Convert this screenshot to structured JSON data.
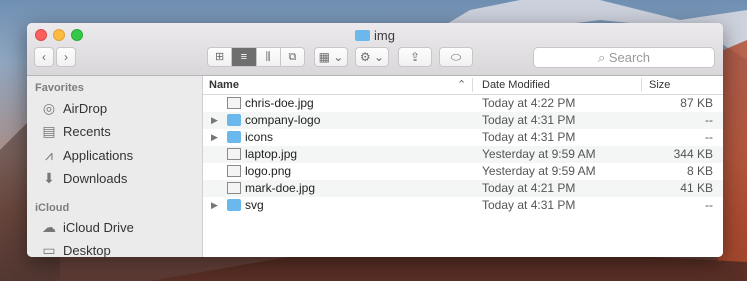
{
  "window": {
    "title": "img"
  },
  "toolbar": {
    "back": "‹",
    "forward": "›",
    "view_icon": "⊞",
    "view_list": "≡",
    "view_columns": "⫼",
    "view_cover": "⧉",
    "group": "▦ ⌄",
    "action": "⚙ ⌄",
    "share": "⇪",
    "tag": "⬭",
    "search_placeholder": "Search"
  },
  "sidebar": {
    "favorites_label": "Favorites",
    "favorites": [
      {
        "label": "AirDrop",
        "icon": "airdrop-icon",
        "glyph": "◎"
      },
      {
        "label": "Recents",
        "icon": "recents-icon",
        "glyph": "▤"
      },
      {
        "label": "Applications",
        "icon": "applications-icon",
        "glyph": "⩘"
      },
      {
        "label": "Downloads",
        "icon": "downloads-icon",
        "glyph": "⬇"
      }
    ],
    "icloud_label": "iCloud",
    "icloud": [
      {
        "label": "iCloud Drive",
        "icon": "cloud-icon",
        "glyph": "☁"
      },
      {
        "label": "Desktop",
        "icon": "desktop-icon",
        "glyph": "▭"
      }
    ]
  },
  "columns": {
    "name": "Name",
    "sort": "⌃",
    "date": "Date Modified",
    "size": "Size"
  },
  "files": [
    {
      "name": "chris-doe.jpg",
      "date": "Today at 4:22 PM",
      "size": "87 KB",
      "kind": "image",
      "expandable": false
    },
    {
      "name": "company-logo",
      "date": "Today at 4:31 PM",
      "size": "--",
      "kind": "folder",
      "expandable": true
    },
    {
      "name": "icons",
      "date": "Today at 4:31 PM",
      "size": "--",
      "kind": "folder",
      "expandable": true
    },
    {
      "name": "laptop.jpg",
      "date": "Yesterday at 9:59 AM",
      "size": "344 KB",
      "kind": "image",
      "expandable": false
    },
    {
      "name": "logo.png",
      "date": "Yesterday at 9:59 AM",
      "size": "8 KB",
      "kind": "image",
      "expandable": false
    },
    {
      "name": "mark-doe.jpg",
      "date": "Today at 4:21 PM",
      "size": "41 KB",
      "kind": "image",
      "expandable": false
    },
    {
      "name": "svg",
      "date": "Today at 4:31 PM",
      "size": "--",
      "kind": "folder",
      "expandable": true
    }
  ],
  "colors": {
    "folder": "#6ab8ec",
    "accent": "#6e6e6e"
  }
}
